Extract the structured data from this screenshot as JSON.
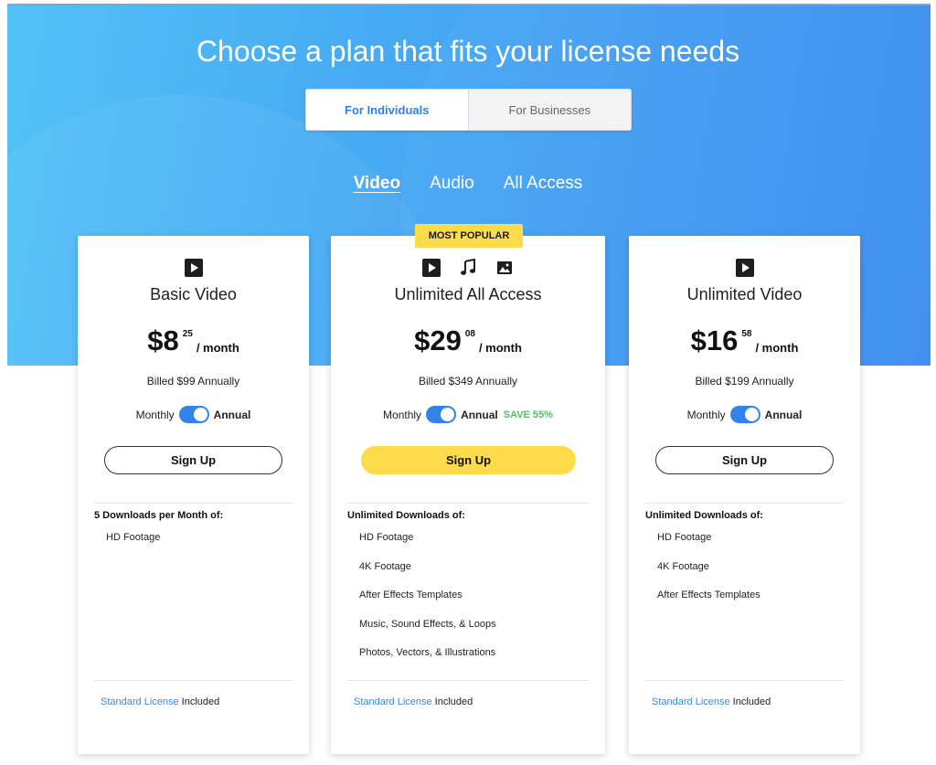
{
  "header": {
    "title": "Choose a plan that fits your license needs",
    "audience_tabs": [
      {
        "label": "For Individuals",
        "active": true
      },
      {
        "label": "For Businesses",
        "active": false
      }
    ],
    "media_tabs": [
      {
        "label": "Video",
        "active": true
      },
      {
        "label": "Audio",
        "active": false
      },
      {
        "label": "All Access",
        "active": false
      }
    ]
  },
  "colors": {
    "accent_blue": "#3384ea",
    "highlight_yellow": "#fddb4a",
    "save_green": "#4fc067",
    "link_blue": "#3a86e0"
  },
  "plans": [
    {
      "icons": [
        "play-icon"
      ],
      "name": "Basic Video",
      "price_whole": "$8",
      "price_cents": "25",
      "period": "/ month",
      "billed": "Billed $99 Annually",
      "toggle_left": "Monthly",
      "toggle_right": "Annual",
      "toggle_on": true,
      "save": "",
      "cta": "Sign Up",
      "features_heading": "5 Downloads per Month of:",
      "features": [
        "HD Footage"
      ],
      "license_link": "Standard License",
      "license_suffix": " Included"
    },
    {
      "badge": "MOST POPULAR",
      "icons": [
        "play-icon",
        "music-note-icon",
        "image-icon"
      ],
      "name": "Unlimited All Access",
      "price_whole": "$29",
      "price_cents": "08",
      "period": "/ month",
      "billed": "Billed $349 Annually",
      "toggle_left": "Monthly",
      "toggle_right": "Annual",
      "toggle_on": true,
      "save": "SAVE 55%",
      "cta": "Sign Up",
      "features_heading": "Unlimited Downloads of:",
      "features": [
        "HD Footage",
        "4K Footage",
        "After Effects Templates",
        "Music, Sound Effects, & Loops",
        "Photos, Vectors, & Illustrations"
      ],
      "license_link": "Standard License",
      "license_suffix": " Included"
    },
    {
      "icons": [
        "play-icon"
      ],
      "name": "Unlimited Video",
      "price_whole": "$16",
      "price_cents": "58",
      "period": "/ month",
      "billed": "Billed $199 Annually",
      "toggle_left": "Monthly",
      "toggle_right": "Annual",
      "toggle_on": true,
      "save": "",
      "cta": "Sign Up",
      "features_heading": "Unlimited Downloads of:",
      "features": [
        "HD Footage",
        "4K Footage",
        "After Effects Templates"
      ],
      "license_link": "Standard License",
      "license_suffix": " Included"
    }
  ]
}
